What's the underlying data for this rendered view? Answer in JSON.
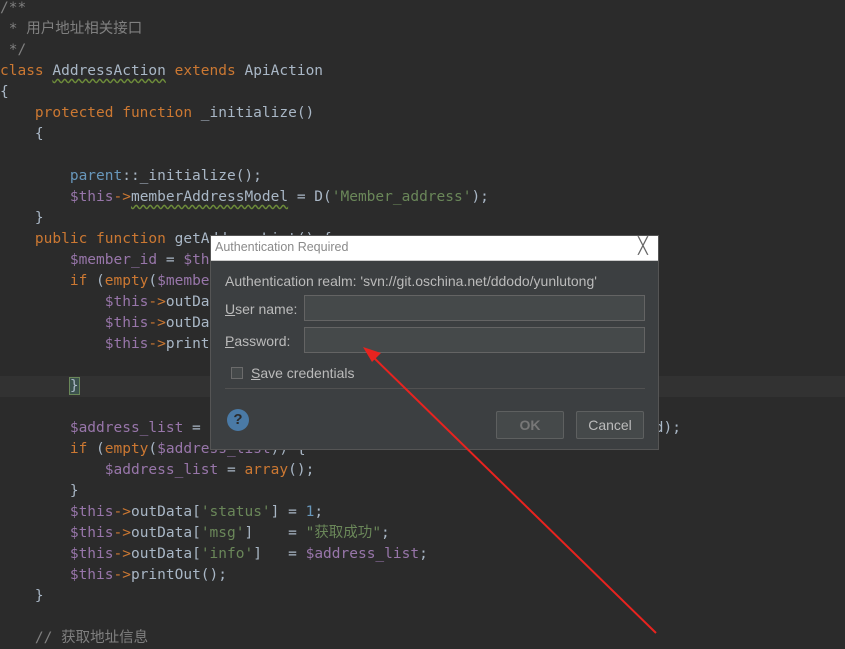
{
  "editor": {
    "lines": [
      [
        [
          "tok-comment",
          "/**"
        ]
      ],
      [
        [
          "tok-comment",
          " * "
        ],
        [
          "tok-ccomment",
          "用户地址相关接口"
        ]
      ],
      [
        [
          "tok-comment",
          " */"
        ]
      ],
      [
        [
          "tok-keyword",
          "class "
        ],
        [
          "tok-class",
          "AddressAction"
        ],
        [
          "tok-keyword",
          " extends "
        ],
        [
          "tok-plain",
          "ApiAction"
        ]
      ],
      [
        [
          "tok-plain",
          "{"
        ]
      ],
      [
        [
          "tok-keyword",
          "    protected function "
        ],
        [
          "tok-plain",
          "_initialize()"
        ]
      ],
      [
        [
          "tok-plain",
          "    {"
        ]
      ],
      [
        [
          "tok-plain",
          ""
        ]
      ],
      [
        [
          "tok-parent",
          "        parent"
        ],
        [
          "tok-plain",
          "::_initialize();"
        ]
      ],
      [
        [
          "tok-var",
          "        $this"
        ],
        [
          "tok-arrow",
          "->"
        ],
        [
          "tok-fieldwavy",
          "memberAddressModel"
        ],
        [
          "tok-plain",
          " = D("
        ],
        [
          "tok-string",
          "'Member_address'"
        ],
        [
          "tok-plain",
          ");"
        ]
      ],
      [
        [
          "tok-plain",
          "    }"
        ]
      ],
      [
        [
          "tok-keyword",
          "    public function "
        ],
        [
          "tok-plain",
          "getAddressList() {"
        ]
      ],
      [
        [
          "tok-var",
          "        $member_id"
        ],
        [
          "tok-plain",
          " = "
        ],
        [
          "tok-var",
          "$this"
        ]
      ],
      [
        [
          "tok-keyword",
          "        if "
        ],
        [
          "tok-plain",
          "("
        ],
        [
          "tok-keyword",
          "empty"
        ],
        [
          "tok-plain",
          "("
        ],
        [
          "tok-var",
          "$member"
        ]
      ],
      [
        [
          "tok-var",
          "            $this"
        ],
        [
          "tok-arrow",
          "->"
        ],
        [
          "tok-plain",
          "outDa"
        ]
      ],
      [
        [
          "tok-var",
          "            $this"
        ],
        [
          "tok-arrow",
          "->"
        ],
        [
          "tok-plain",
          "outDa"
        ]
      ],
      [
        [
          "tok-var",
          "            $this"
        ],
        [
          "tok-arrow",
          "->"
        ],
        [
          "tok-plain",
          "print"
        ]
      ],
      [
        [
          "tok-plain",
          ""
        ]
      ],
      [
        [
          "tok-plain",
          "        "
        ],
        [
          "tok-brace-hl",
          "}"
        ]
      ],
      [
        [
          "tok-plain",
          ""
        ]
      ],
      [
        [
          "tok-var",
          "        $address_list"
        ],
        [
          "tok-plain",
          " = "
        ],
        [
          "tok-plain",
          "                                                  id);"
        ]
      ],
      [
        [
          "tok-keyword",
          "        if "
        ],
        [
          "tok-plain",
          "("
        ],
        [
          "tok-keyword",
          "empty"
        ],
        [
          "tok-plain",
          "("
        ],
        [
          "tok-var",
          "$address_list"
        ],
        [
          "tok-plain",
          ")) {"
        ]
      ],
      [
        [
          "tok-var",
          "            $address_list"
        ],
        [
          "tok-plain",
          " = "
        ],
        [
          "tok-keyword",
          "array"
        ],
        [
          "tok-plain",
          "();"
        ]
      ],
      [
        [
          "tok-plain",
          "        }"
        ]
      ],
      [
        [
          "tok-var",
          "        $this"
        ],
        [
          "tok-arrow",
          "->"
        ],
        [
          "tok-plain",
          "outData["
        ],
        [
          "tok-string",
          "'status'"
        ],
        [
          "tok-plain",
          "] = "
        ],
        [
          "tok-number",
          "1"
        ],
        [
          "tok-plain",
          ";"
        ]
      ],
      [
        [
          "tok-var",
          "        $this"
        ],
        [
          "tok-arrow",
          "->"
        ],
        [
          "tok-plain",
          "outData["
        ],
        [
          "tok-string",
          "'msg'"
        ],
        [
          "tok-plain",
          "]    = "
        ],
        [
          "tok-string",
          "\""
        ],
        [
          "tok-cjk",
          "获取成功"
        ],
        [
          "tok-string",
          "\""
        ],
        [
          "tok-plain",
          ";"
        ]
      ],
      [
        [
          "tok-var",
          "        $this"
        ],
        [
          "tok-arrow",
          "->"
        ],
        [
          "tok-plain",
          "outData["
        ],
        [
          "tok-string",
          "'info'"
        ],
        [
          "tok-plain",
          "]   = "
        ],
        [
          "tok-var",
          "$address_list"
        ],
        [
          "tok-plain",
          ";"
        ]
      ],
      [
        [
          "tok-var",
          "        $this"
        ],
        [
          "tok-arrow",
          "->"
        ],
        [
          "tok-plain",
          "printOut();"
        ]
      ],
      [
        [
          "tok-plain",
          "    }"
        ]
      ],
      [
        [
          "tok-plain",
          ""
        ]
      ],
      [
        [
          "tok-comment",
          "    // "
        ],
        [
          "tok-ccomment",
          "获取地址信息"
        ]
      ]
    ]
  },
  "dialog": {
    "title": "Authentication Required",
    "close_symbol": "╳",
    "realm": "Authentication realm: 'svn://git.oschina.net/ddodo/yunlutong'",
    "user_label_u": "U",
    "user_label_rest": "ser name:",
    "user_value": "",
    "password_label_p": "P",
    "password_label_rest": "assword:",
    "password_value": "",
    "save_label_s": "S",
    "save_label_rest": "ave credentials",
    "save_checked": false,
    "help_symbol": "?",
    "ok_label": "OK",
    "cancel_label": "Cancel"
  },
  "colors": {
    "arrow": "#e8231f",
    "background": "#2b2b2b",
    "dialog_bg": "#3c3f41"
  }
}
